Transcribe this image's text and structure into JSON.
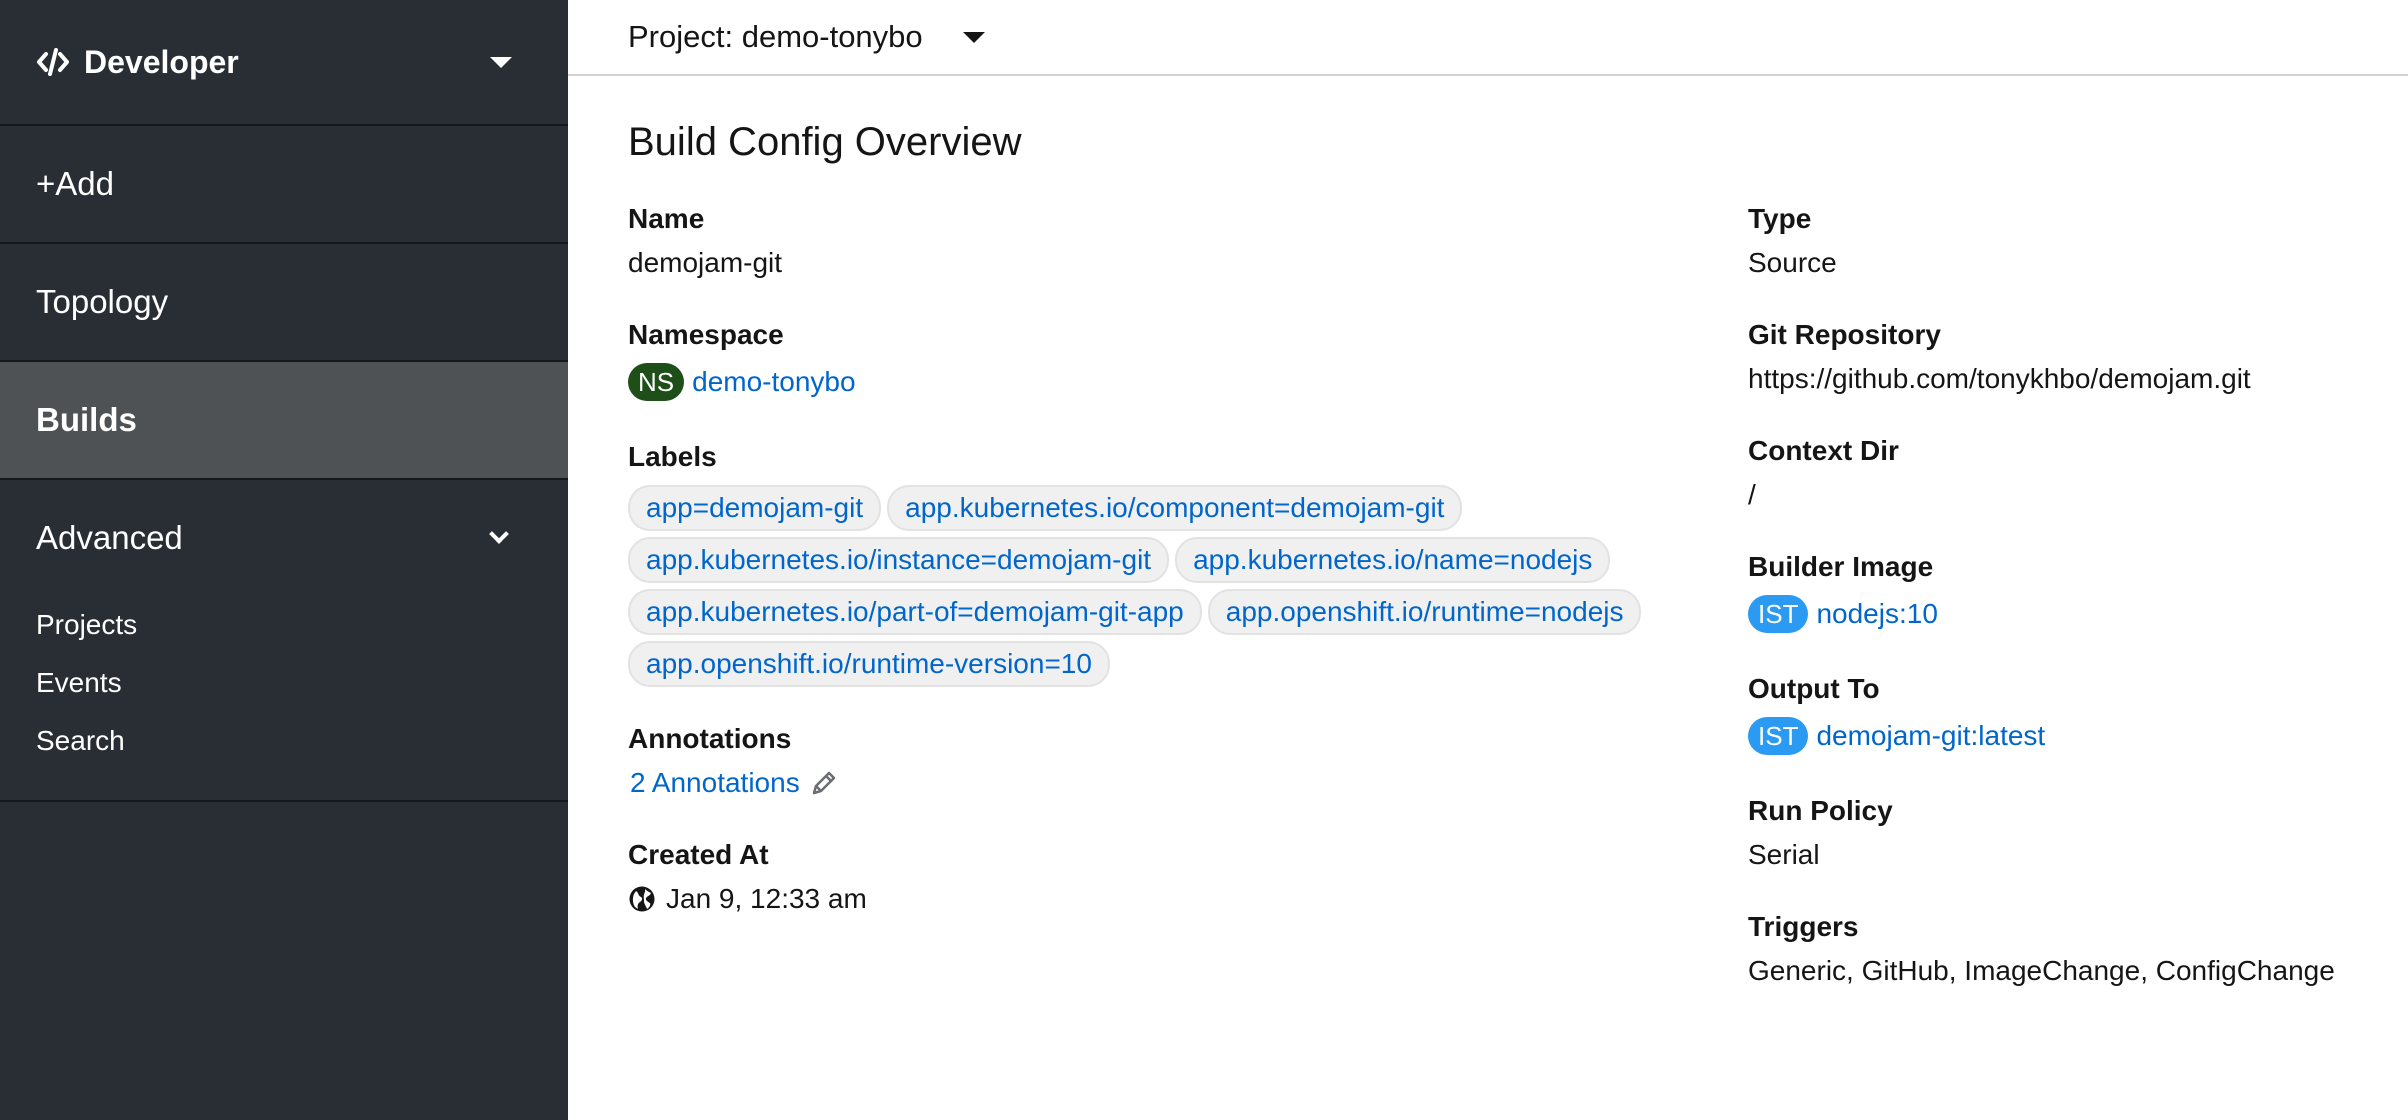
{
  "sidebar": {
    "perspective": "Developer",
    "items": [
      {
        "label": "+Add"
      },
      {
        "label": "Topology"
      },
      {
        "label": "Builds"
      }
    ],
    "advanced": {
      "label": "Advanced",
      "items": [
        "Projects",
        "Events",
        "Search"
      ]
    }
  },
  "topbar": {
    "project": "Project: demo-tonybo"
  },
  "page": {
    "title": "Build Config Overview"
  },
  "details_left": {
    "name_label": "Name",
    "name_value": "demojam-git",
    "namespace_label": "Namespace",
    "namespace_badge": "NS",
    "namespace_value": "demo-tonybo",
    "labels_label": "Labels",
    "labels": [
      "app=demojam-git",
      "app.kubernetes.io/component=demojam-git",
      "app.kubernetes.io/instance=demojam-git",
      "app.kubernetes.io/name=nodejs",
      "app.kubernetes.io/part-of=demojam-git-app",
      "app.openshift.io/runtime=nodejs",
      "app.openshift.io/runtime-version=10"
    ],
    "annotations_label": "Annotations",
    "annotations_value": "2 Annotations",
    "created_label": "Created At",
    "created_value": "Jan 9, 12:33 am"
  },
  "details_right": {
    "type_label": "Type",
    "type_value": "Source",
    "git_label": "Git Repository",
    "git_value": "https://github.com/tonykhbo/demojam.git",
    "context_label": "Context Dir",
    "context_value": "/",
    "builder_label": "Builder Image",
    "builder_badge": "IST",
    "builder_value": "nodejs:10",
    "output_label": "Output To",
    "output_badge": "IST",
    "output_value": "demojam-git:latest",
    "policy_label": "Run Policy",
    "policy_value": "Serial",
    "triggers_label": "Triggers",
    "triggers_value": "Generic, GitHub, ImageChange, ConfigChange"
  },
  "icons": {
    "perspective": "code-icon",
    "perspective_toggle": "caret-down-icon",
    "advanced_toggle": "chevron-down-icon",
    "project_toggle": "caret-down-icon",
    "annotations_edit": "pencil-icon",
    "created_at": "globe-icon"
  },
  "colors": {
    "sidebar_bg": "#292e34",
    "sidebar_active": "#4f5255",
    "link": "#0066cc",
    "ns_badge": "#1e4f18",
    "ist_badge": "#2b9af3"
  }
}
